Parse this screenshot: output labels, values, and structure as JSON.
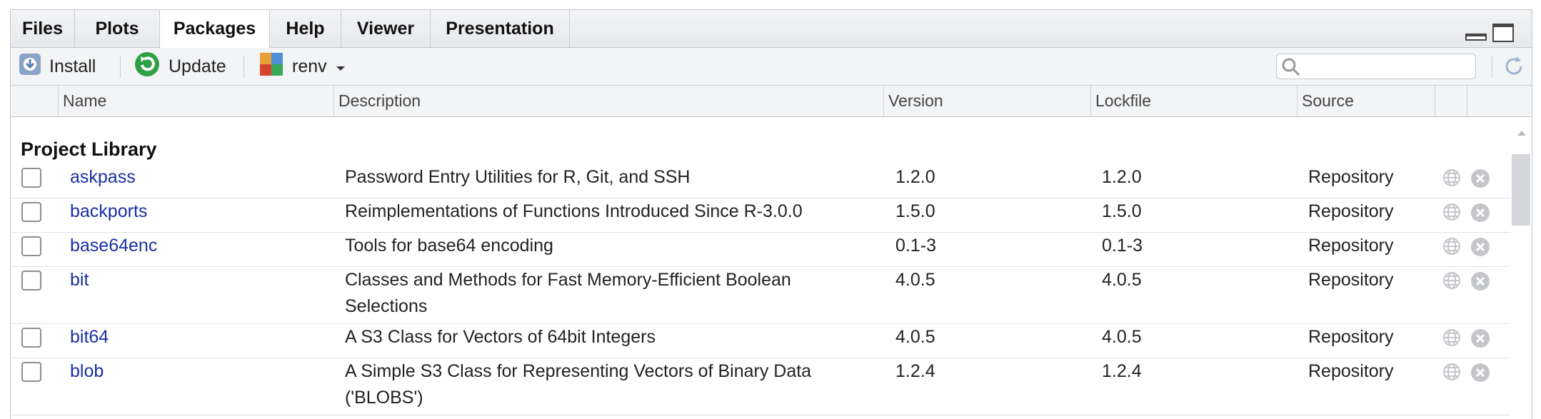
{
  "tabs": [
    {
      "label": "Files",
      "active": false
    },
    {
      "label": "Plots",
      "active": false
    },
    {
      "label": "Packages",
      "active": true
    },
    {
      "label": "Help",
      "active": false
    },
    {
      "label": "Viewer",
      "active": false
    },
    {
      "label": "Presentation",
      "active": false
    }
  ],
  "toolbar": {
    "install_label": "Install",
    "update_label": "Update",
    "renv_label": "renv",
    "search_placeholder": ""
  },
  "columns": {
    "name": "Name",
    "description": "Description",
    "version": "Version",
    "lockfile": "Lockfile",
    "source": "Source"
  },
  "section_title": "Project Library",
  "packages": [
    {
      "name": "askpass",
      "description": "Password Entry Utilities for R, Git, and SSH",
      "version": "1.2.0",
      "lockfile": "1.2.0",
      "source": "Repository"
    },
    {
      "name": "backports",
      "description": "Reimplementations of Functions Introduced Since R-3.0.0",
      "version": "1.5.0",
      "lockfile": "1.5.0",
      "source": "Repository"
    },
    {
      "name": "base64enc",
      "description": "Tools for base64 encoding",
      "version": "0.1-3",
      "lockfile": "0.1-3",
      "source": "Repository"
    },
    {
      "name": "bit",
      "description": "Classes and Methods for Fast Memory-Efficient Boolean Selections",
      "version": "4.0.5",
      "lockfile": "4.0.5",
      "source": "Repository"
    },
    {
      "name": "bit64",
      "description": "A S3 Class for Vectors of 64bit Integers",
      "version": "4.0.5",
      "lockfile": "4.0.5",
      "source": "Repository"
    },
    {
      "name": "blob",
      "description": "A Simple S3 Class for Representing Vectors of Binary Data ('BLOBS')",
      "version": "1.2.4",
      "lockfile": "1.2.4",
      "source": "Repository"
    }
  ],
  "colors": {
    "link": "#1a2fa6",
    "update_green": "#2ea043",
    "accent_blue": "#4f8fd6"
  }
}
